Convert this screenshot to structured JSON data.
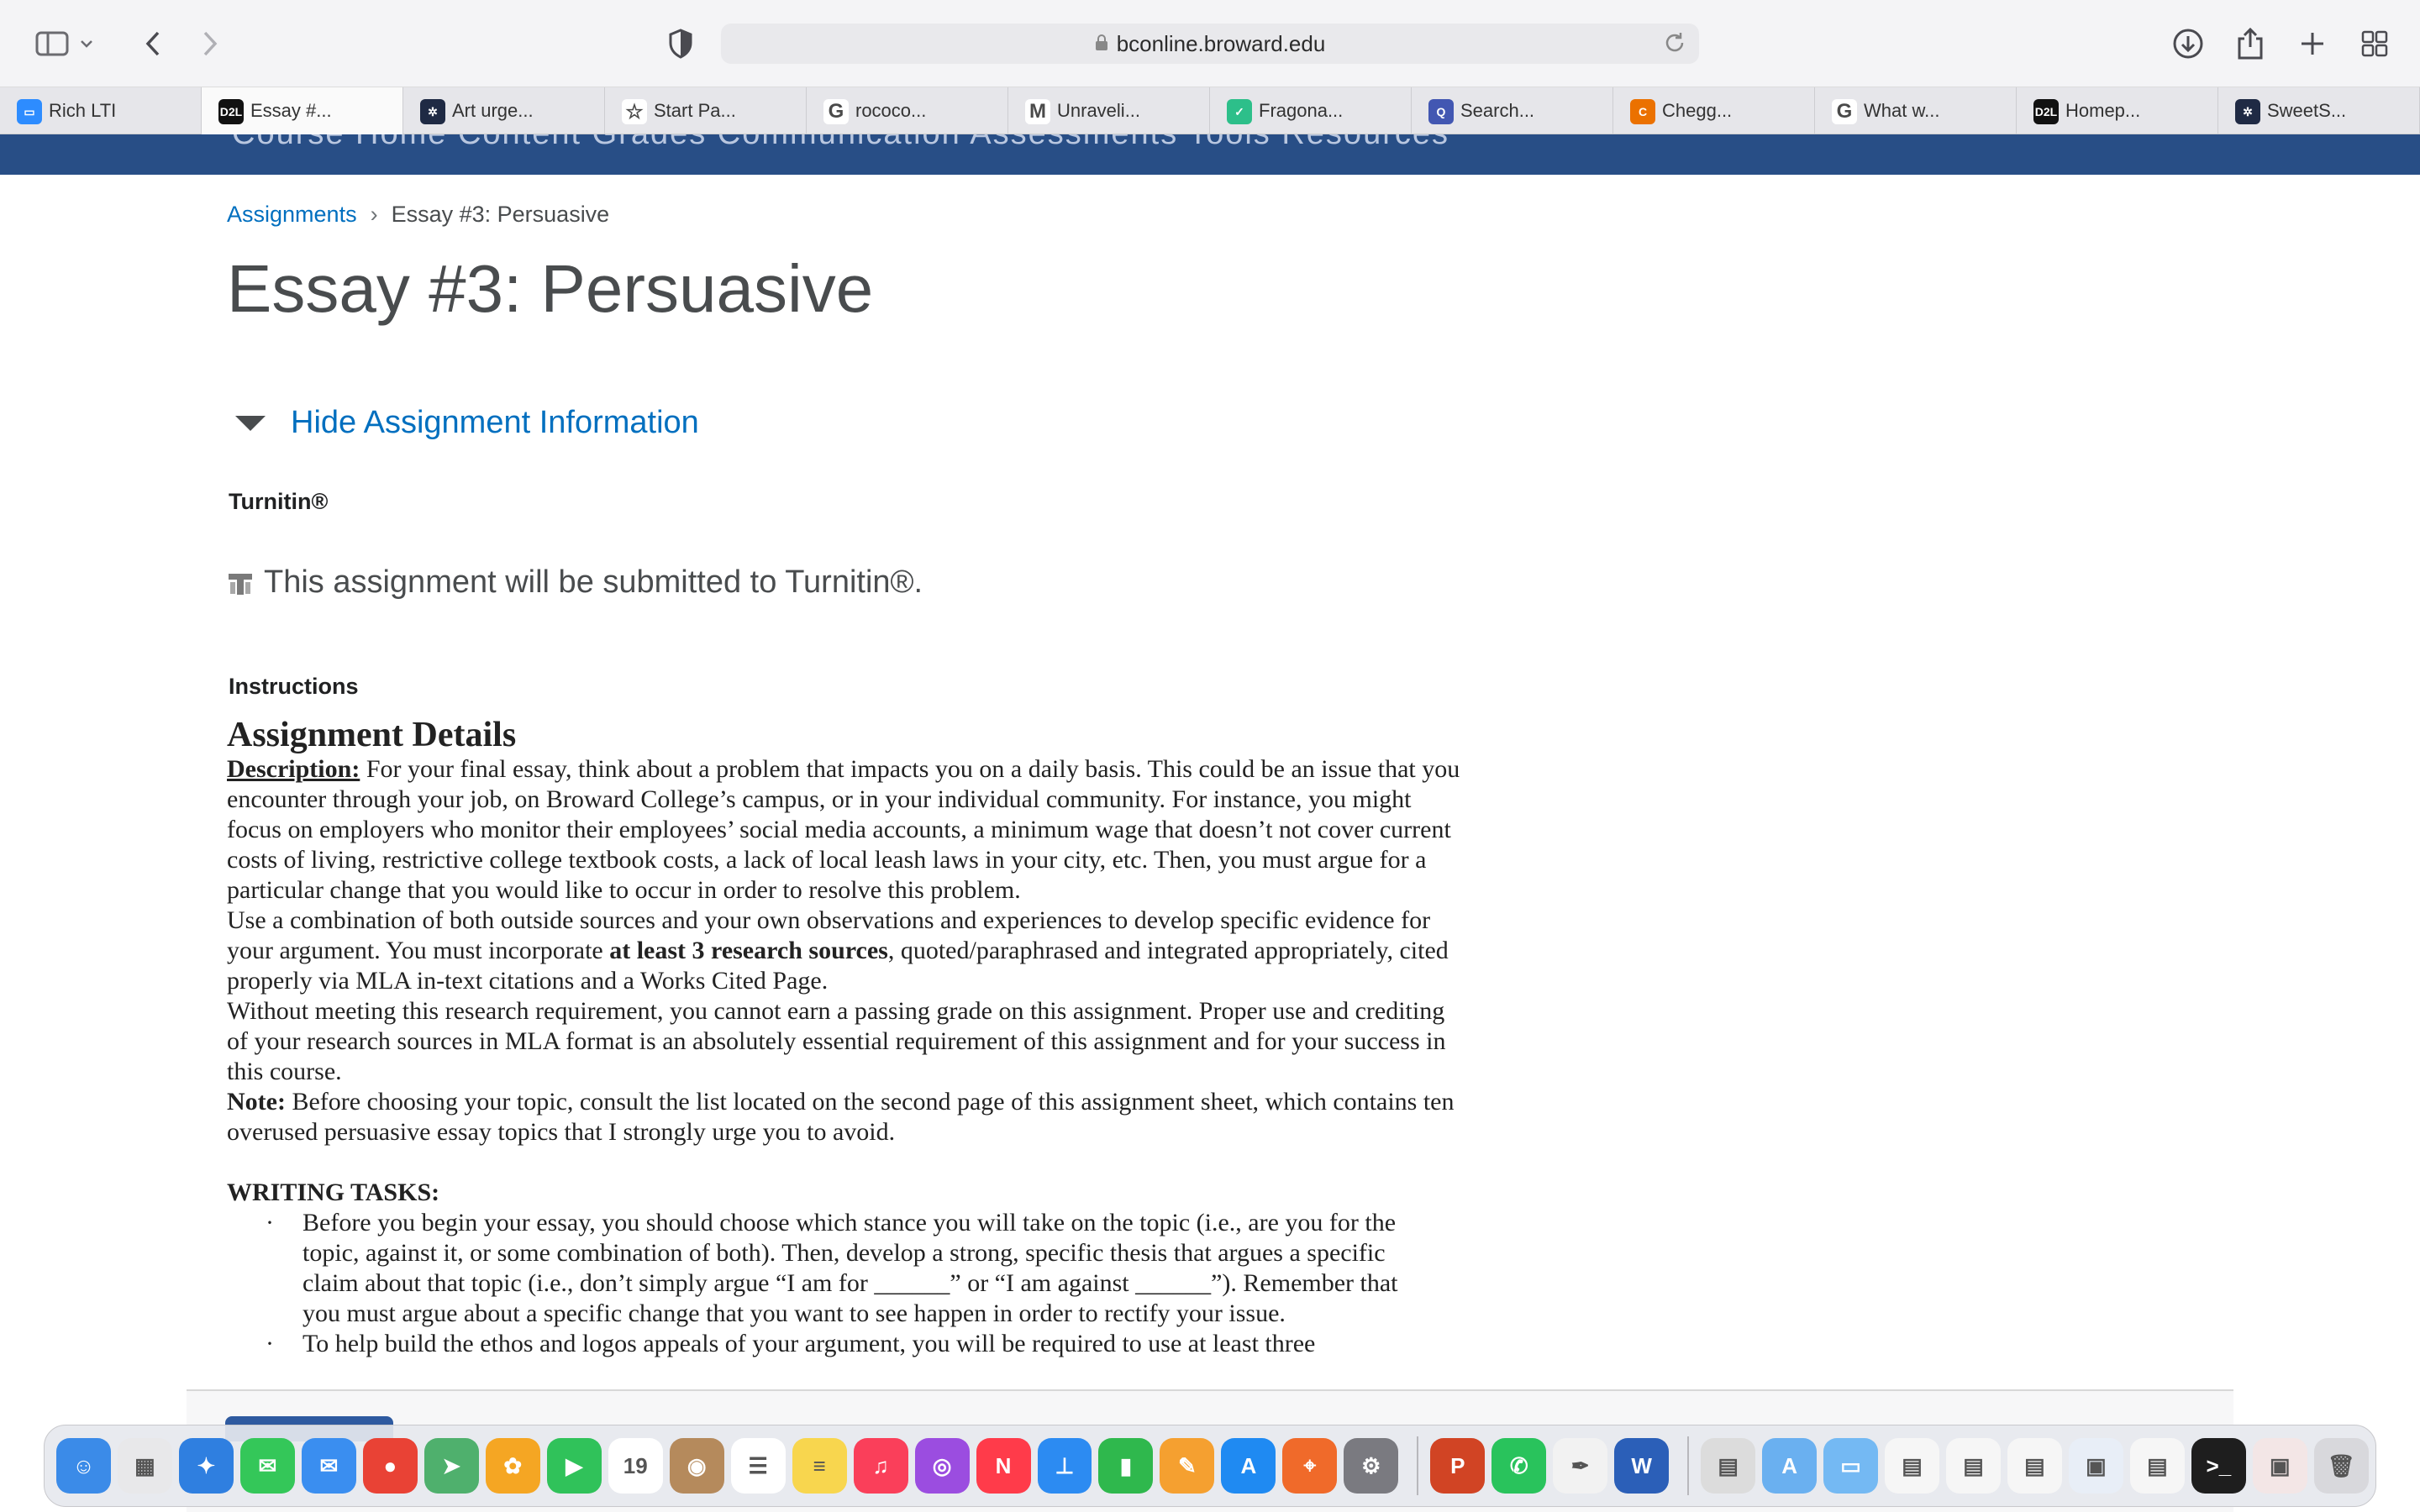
{
  "browser": {
    "url": "bconline.broward.edu",
    "tabs": [
      {
        "label": "Rich LTI",
        "favicon": "zoom-icon",
        "color": "#2d8cff",
        "glyph": "▭"
      },
      {
        "label": "Essay #...",
        "favicon": "d2l-icon",
        "color": "#111111",
        "glyph": "D2L",
        "active": true
      },
      {
        "label": "Art urge...",
        "favicon": "openai-icon",
        "color": "#1f2a44",
        "glyph": "✲"
      },
      {
        "label": "Start Pa...",
        "favicon": "star-icon",
        "color": "#ffffff",
        "glyph": "☆"
      },
      {
        "label": "rococo...",
        "favicon": "google-icon",
        "color": "#ffffff",
        "glyph": "G"
      },
      {
        "label": "Unraveli...",
        "favicon": "medium-icon",
        "color": "#ffffff",
        "glyph": "M"
      },
      {
        "label": "Fragona...",
        "favicon": "shield-check-icon",
        "color": "#2dbf8a",
        "glyph": "✓"
      },
      {
        "label": "Search...",
        "favicon": "quizlet-icon",
        "color": "#4257b2",
        "glyph": "Q"
      },
      {
        "label": "Chegg...",
        "favicon": "chegg-icon",
        "color": "#eb7100",
        "glyph": "C"
      },
      {
        "label": "What w...",
        "favicon": "google-icon",
        "color": "#ffffff",
        "glyph": "G"
      },
      {
        "label": "Homep...",
        "favicon": "d2l-icon",
        "color": "#111111",
        "glyph": "D2L"
      },
      {
        "label": "SweetS...",
        "favicon": "openai-icon",
        "color": "#1f2a44",
        "glyph": "✲"
      }
    ]
  },
  "nav": {
    "text": "Course Home    Content    Grades    Communication    Assessments    Tools    Resources"
  },
  "breadcrumb": {
    "link": "Assignments",
    "separator": "›",
    "current": "Essay #3: Persuasive"
  },
  "page_title": "Essay #3: Persuasive",
  "toggle_label": "Hide Assignment Information",
  "turnitin": {
    "heading": "Turnitin®",
    "notice": "This assignment will be submitted to Turnitin®."
  },
  "instructions_label": "Instructions",
  "details": {
    "heading": "Assignment Details",
    "description_label": "Description:",
    "description": "  For your final essay, think about a problem that impacts you on a daily basis. This could be an issue that you encounter through your job, on Broward College’s campus, or in your individual community. For instance, you might focus on employers who monitor their employees’ social media accounts, a minimum wage that doesn’t not cover current costs of living, restrictive college textbook costs, a lack of local leash laws in your city, etc. Then, you must argue for a particular change that you would like to occur in order to resolve this problem.",
    "p2_a": "Use a combination of both outside sources and your own observations and experiences to develop specific evidence for your argument. You must incorporate ",
    "p2_b": "at least 3 research sources",
    "p2_c": ", quoted/paraphrased and integrated appropriately, cited properly via MLA in-text citations and a Works Cited Page.",
    "p3": "Without meeting this research requirement, you cannot earn a passing grade on this assignment. Proper use and crediting of your research sources in MLA format is an absolutely essential requirement of this assignment and for your success in this course.",
    "note_label": "Note:",
    "note": " Before choosing your topic, consult the list located on the second page of this assignment sheet, which contains ten overused persuasive essay topics that I strongly urge you to avoid.",
    "tasks_heading": "WRITING TASKS:",
    "bullet1": "Before you begin your essay, you should choose which stance you will take on the topic (i.e., are you for the topic, against it, or some combination of both). Then, develop a strong, specific thesis that argues a specific claim about that topic (i.e., don’t simply argue “I am for ______” or “I am against ______”). Remember that you must argue about a specific change that you want to see happen in order to rectify your issue.",
    "bullet2": "To help build the ethos and logos appeals of your argument, you will be required to use at least three",
    "bullet_marker": "·"
  },
  "dock": [
    {
      "name": "finder-icon",
      "color": "#3b8be8",
      "glyph": "☺"
    },
    {
      "name": "launchpad-icon",
      "color": "#e8e8ea",
      "glyph": "▦"
    },
    {
      "name": "safari-icon",
      "color": "#2f7fe0",
      "glyph": "✦"
    },
    {
      "name": "messages-icon",
      "color": "#34c759",
      "glyph": "✉"
    },
    {
      "name": "mail-icon",
      "color": "#3a8ef0",
      "glyph": "✉"
    },
    {
      "name": "chrome-icon",
      "color": "#e94235",
      "glyph": "●"
    },
    {
      "name": "maps-icon",
      "color": "#4fb06d",
      "glyph": "➤"
    },
    {
      "name": "photos-icon",
      "color": "#f5a623",
      "glyph": "✿"
    },
    {
      "name": "facetime-icon",
      "color": "#30c25a",
      "glyph": "▶"
    },
    {
      "name": "calendar-icon",
      "color": "#ffffff",
      "glyph": "19"
    },
    {
      "name": "contacts-icon",
      "color": "#b58a5c",
      "glyph": "◉"
    },
    {
      "name": "reminders-icon",
      "color": "#ffffff",
      "glyph": "☰"
    },
    {
      "name": "notes-icon",
      "color": "#f8d64e",
      "glyph": "≡"
    },
    {
      "name": "music-icon",
      "color": "#fa3f5a",
      "glyph": "♫"
    },
    {
      "name": "podcasts-icon",
      "color": "#9b4de0",
      "glyph": "◎"
    },
    {
      "name": "news-icon",
      "color": "#ff3b4a",
      "glyph": "N"
    },
    {
      "name": "keynote-icon",
      "color": "#2c8bf2",
      "glyph": "⊥"
    },
    {
      "name": "numbers-icon",
      "color": "#2fb84d",
      "glyph": "▮"
    },
    {
      "name": "pages-icon",
      "color": "#f5a030",
      "glyph": "✎"
    },
    {
      "name": "app-store-icon",
      "color": "#1f8af2",
      "glyph": "A"
    },
    {
      "name": "instruments-icon",
      "color": "#f06a2a",
      "glyph": "⌖"
    },
    {
      "name": "system-preferences-icon",
      "color": "#7a7a80",
      "glyph": "⚙"
    },
    {
      "separator": true
    },
    {
      "name": "powerpoint-icon",
      "color": "#d14424",
      "glyph": "P"
    },
    {
      "name": "whatsapp-icon",
      "color": "#29c35c",
      "glyph": "✆"
    },
    {
      "name": "textedit-icon",
      "color": "#f2f2f2",
      "glyph": "✒"
    },
    {
      "name": "word-icon",
      "color": "#2b5fb8",
      "glyph": "W"
    },
    {
      "separator": true
    },
    {
      "name": "document-icon",
      "color": "#dcdcdc",
      "glyph": "▤"
    },
    {
      "name": "app-folder-icon",
      "color": "#6ab0f0",
      "glyph": "A"
    },
    {
      "name": "folder-icon",
      "color": "#74b9f3",
      "glyph": "▭"
    },
    {
      "name": "document-icon",
      "color": "#f6f6f6",
      "glyph": "▤"
    },
    {
      "name": "document-icon",
      "color": "#f6f6f6",
      "glyph": "▤"
    },
    {
      "name": "document-icon",
      "color": "#f6f6f6",
      "glyph": "▤"
    },
    {
      "name": "screenshot-icon",
      "color": "#e8eef7",
      "glyph": "▣"
    },
    {
      "name": "document-icon",
      "color": "#f6f6f6",
      "glyph": "▤"
    },
    {
      "name": "terminal-icon",
      "color": "#1e1e1e",
      "glyph": ">_"
    },
    {
      "name": "screenshot-icon",
      "color": "#f3e6e6",
      "glyph": "▣"
    },
    {
      "name": "trash-icon",
      "color": "#d8d8dc",
      "glyph": "🗑"
    }
  ]
}
